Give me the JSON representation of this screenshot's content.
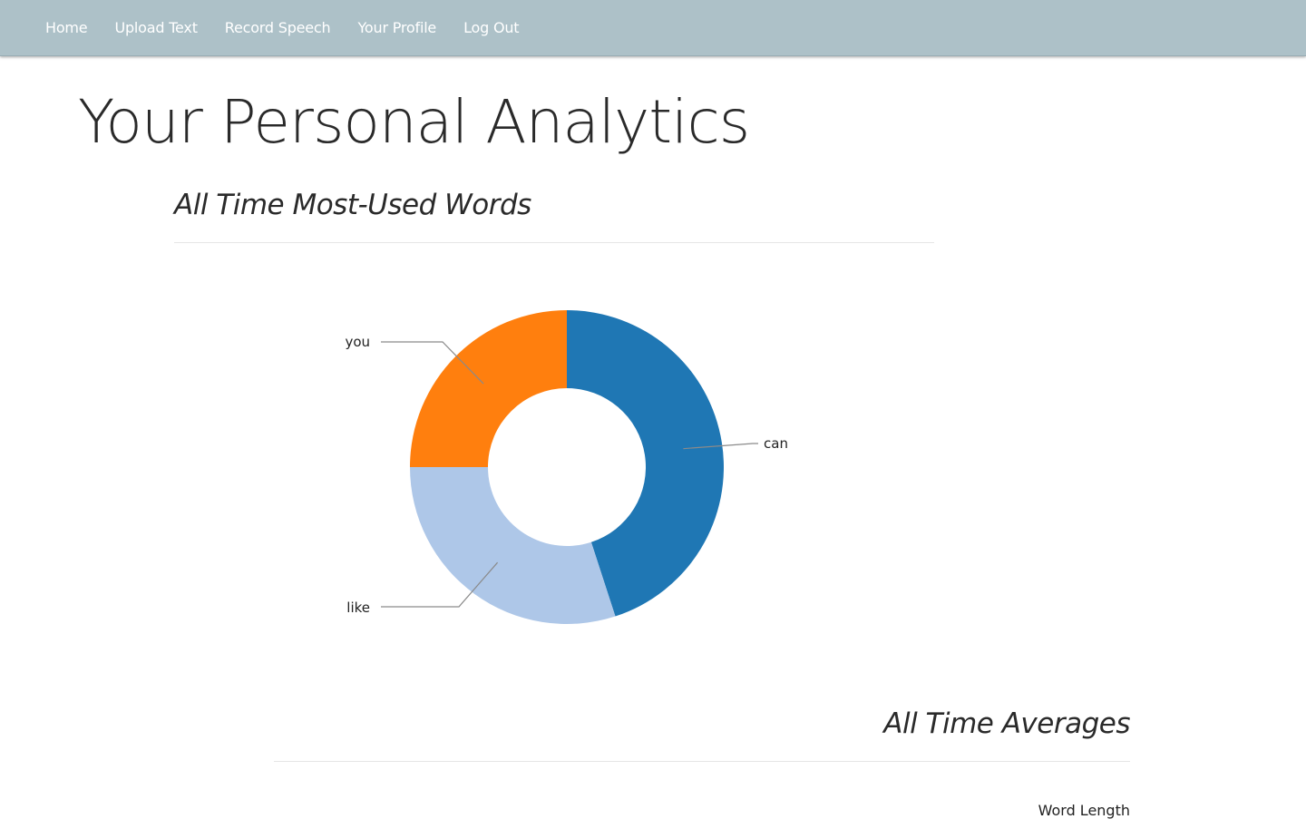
{
  "nav": {
    "items": [
      "Home",
      "Upload Text",
      "Record Speech",
      "Your Profile",
      "Log Out"
    ]
  },
  "page": {
    "title": "Your Personal Analytics"
  },
  "sections": {
    "most_used_words": {
      "heading": "All Time Most-Used Words"
    },
    "averages": {
      "heading": "All Time Averages",
      "stat_label": "Word Length"
    }
  },
  "chart_data": {
    "type": "pie",
    "variant": "donut",
    "categories": [
      "can",
      "like",
      "you"
    ],
    "values": [
      45,
      30,
      25
    ],
    "colors": [
      "#1f77b4",
      "#aec7e8",
      "#ff7f0e"
    ],
    "title": ""
  },
  "colors": {
    "navbar": "#adc1c8",
    "nav_text": "#ffffff",
    "heading_text": "#2a2a2a"
  }
}
